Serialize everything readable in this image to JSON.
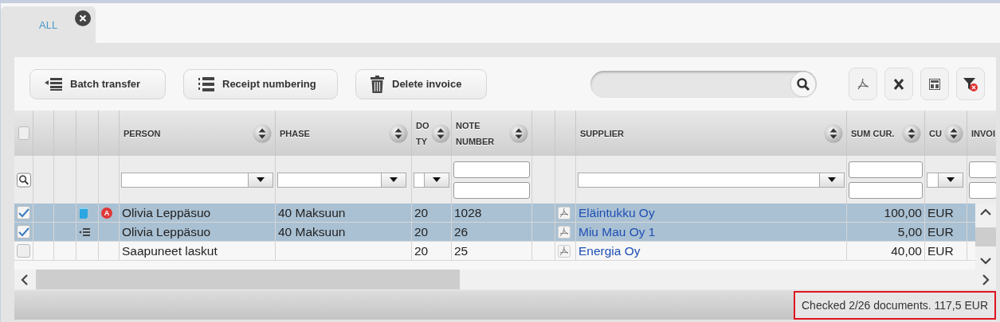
{
  "tabs": [
    {
      "label": "ALL",
      "selected": true,
      "closable": true
    }
  ],
  "toolbar": {
    "buttons": [
      {
        "label": "Batch transfer"
      },
      {
        "label": "Receipt numbering"
      },
      {
        "label": "Delete invoice"
      }
    ]
  },
  "table": {
    "columns": [
      {
        "kind": "check",
        "checked": false,
        "filter": {
          "kind": "search"
        }
      },
      {
        "kind": "blank"
      },
      {
        "kind": "blank"
      },
      {
        "kind": "status"
      },
      {
        "kind": "alert"
      },
      {
        "kind": "text",
        "label": "PERSON",
        "sortable": true,
        "filter": {
          "kind": "select"
        }
      },
      {
        "kind": "text",
        "label": "PHASE",
        "sortable": true,
        "filter": {
          "kind": "small-select"
        }
      },
      {
        "kind": "text",
        "label": "DO TY",
        "sortable": true,
        "filter": {
          "kind": "tiny-select"
        }
      },
      {
        "kind": "text",
        "label": "NOTE NUMBER",
        "sortable": true,
        "filter": {
          "kind": "range"
        }
      },
      {
        "kind": "blank"
      },
      {
        "kind": "pdf"
      },
      {
        "kind": "link",
        "label": "SUPPLIER",
        "sortable": true,
        "filter": {
          "kind": "select"
        }
      },
      {
        "kind": "number",
        "label": "SUM CUR.",
        "sortable": true,
        "filter": {
          "kind": "range"
        }
      },
      {
        "kind": "text",
        "label": "CU",
        "sortable": true,
        "filter": {
          "kind": "tiny-select"
        }
      },
      {
        "kind": "text",
        "label": "INVOI",
        "filter": {
          "kind": "range"
        }
      }
    ],
    "rows": [
      {
        "checked": true,
        "status_icon": {
          "kind": "document"
        },
        "pdf": true,
        "cells": [
          "",
          "",
          "",
          "",
          "A",
          "Olivia Leppäsuo",
          "40 Maksuun",
          "20",
          "1028",
          "",
          "",
          "Eläintukku Oy",
          "100,00",
          "EUR",
          ""
        ]
      },
      {
        "checked": true,
        "status_icon": {
          "kind": "transfer"
        },
        "pdf": true,
        "cells": [
          "",
          "",
          "",
          "",
          "",
          "Olivia Leppäsuo",
          "40 Maksuun",
          "20",
          "26",
          "",
          "",
          "Miu Mau Oy 1",
          "5,00",
          "EUR",
          ""
        ]
      },
      {
        "checked": false,
        "pdf": true,
        "cells": [
          "",
          "",
          "",
          "",
          "",
          "Saapuneet laskut",
          "",
          "20",
          "25",
          "",
          "",
          "Energia Oy",
          "40,00",
          "EUR",
          ""
        ]
      }
    ]
  },
  "status_bar": {
    "text": "Checked 2/26 documents. 117,5 EUR",
    "highlighted": true
  }
}
